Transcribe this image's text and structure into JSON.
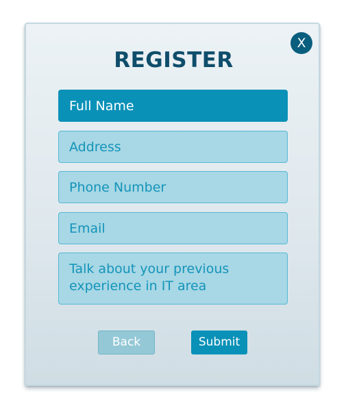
{
  "dialog": {
    "title": "REGISTER",
    "close_label": "X"
  },
  "form": {
    "fields": [
      {
        "placeholder": "Full Name",
        "state": "focused"
      },
      {
        "placeholder": "Address"
      },
      {
        "placeholder": "Phone Number"
      },
      {
        "placeholder": "Email"
      },
      {
        "placeholder": "Talk about your previous\nexperience in IT area"
      }
    ]
  },
  "actions": {
    "back_label": "Back",
    "submit_label": "Submit"
  },
  "colors": {
    "accent": "#0a91b8",
    "title": "#0f4d6b",
    "close_button": "#0a5e7e",
    "field_bg": "#a8d7e5",
    "field_text": "#1394b9"
  }
}
